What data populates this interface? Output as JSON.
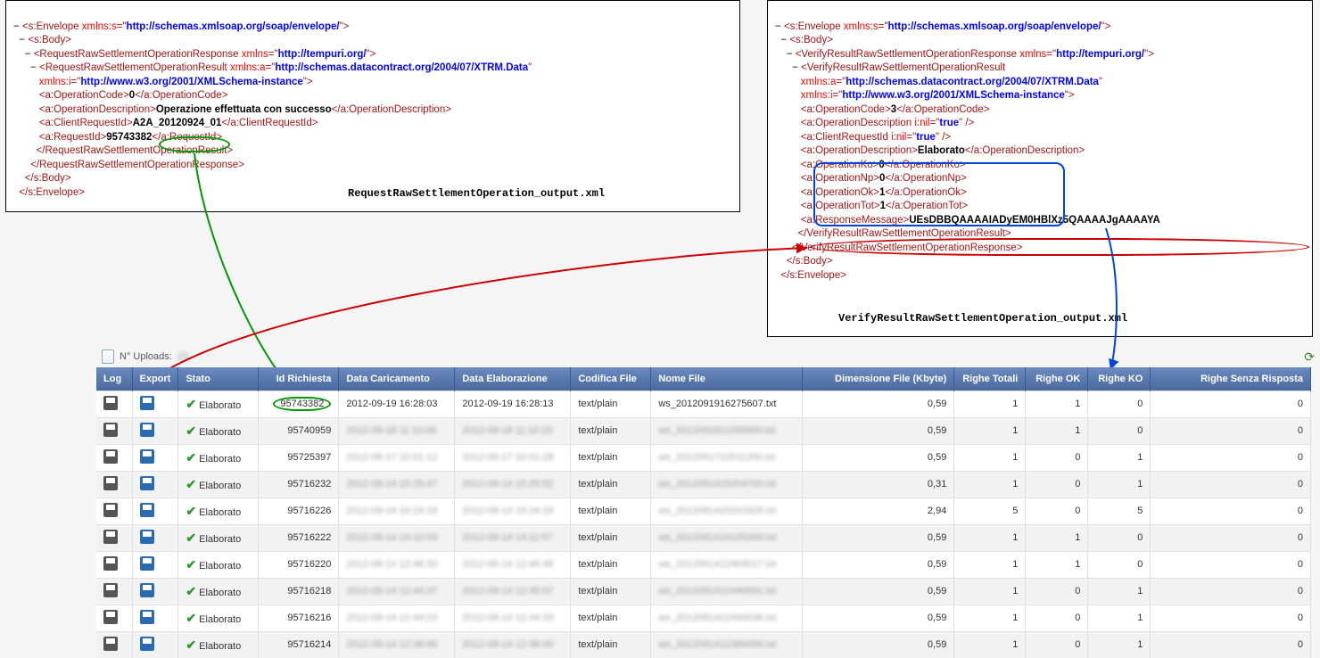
{
  "left_xml": {
    "envelope_open": "s:Envelope",
    "envelope_attr_name": "xmlns:s",
    "envelope_attr_val": "http://schemas.xmlsoap.org/soap/envelope/",
    "body": "s:Body",
    "resp": "RequestRawSettlementOperationResponse",
    "resp_attr_name": "xmlns",
    "resp_attr_val": "http://tempuri.org/",
    "result": "RequestRawSettlementOperationResult",
    "result_a_name": "xmlns:a",
    "result_a_val": "http://schemas.datacontract.org/2004/07/XTRM.Data",
    "result_i_name": "xmlns:i",
    "result_i_val": "http://www.w3.org/2001/XMLSchema-instance",
    "opcode_tag": "a:OperationCode",
    "opcode_val": "0",
    "opdesc_tag": "a:OperationDescription",
    "opdesc_val": "Operazione effettuata con successo",
    "clientreq_tag": "a:ClientRequestId",
    "clientreq_val": "A2A_20120924_01",
    "reqid_tag": "a:RequestId",
    "reqid_val": "95743382",
    "filename": "RequestRawSettlementOperation_output.xml"
  },
  "right_xml": {
    "envelope_open": "s:Envelope",
    "envelope_attr_name": "xmlns:s",
    "envelope_attr_val": "http://schemas.xmlsoap.org/soap/envelope/",
    "body": "s:Body",
    "resp": "VerifyResultRawSettlementOperationResponse",
    "resp_attr_name": "xmlns",
    "resp_attr_val": "http://tempuri.org/",
    "result": "VerifyResultRawSettlementOperationResult",
    "result_a_name": "xmlns:a",
    "result_a_val": "http://schemas.datacontract.org/2004/07/XTRM.Data",
    "result_i_name": "xmlns:i",
    "result_i_val": "http://www.w3.org/2001/XMLSchema-instance",
    "opcode_tag": "a:OperationCode",
    "opcode_val": "3",
    "opdesc_tag_nil": "a:OperationDescription",
    "nil_attr": "i:nil",
    "nil_val": "true",
    "clientreq_tag_nil": "a:ClientRequestId",
    "opdesc_tag": "a:OperationDescription",
    "opdesc_val": "Elaborato",
    "opko_tag": "a:OperationKo",
    "opko_val": "0",
    "opnp_tag": "a:OperationNp",
    "opnp_val": "0",
    "opok_tag": "a:OperationOk",
    "opok_val": "1",
    "optot_tag": "a:OperationTot",
    "optot_val": "1",
    "respmsg_tag": "a:ResponseMessage",
    "respmsg_val": "UEsDBBQAAAAIADyEM0HBlXz5QAAAAJgAAAAYA",
    "filename": "VerifyResultRawSettlementOperation_output.xml"
  },
  "uploads_label": "N° Uploads:",
  "uploads_count": "23",
  "table": {
    "headers": {
      "log": "Log",
      "export": "Export",
      "stato": "Stato",
      "id": "Id Richiesta",
      "dataC": "Data Caricamento",
      "dataE": "Data Elaborazione",
      "codifica": "Codifica File",
      "nome": "Nome File",
      "dim": "Dimensione File (Kbyte)",
      "tot": "Righe Totali",
      "ok": "Righe OK",
      "ko": "Righe KO",
      "sr": "Righe Senza Risposta"
    },
    "rows": [
      {
        "stato": "Elaborato",
        "id": "95743382",
        "dataC": "2012-09-19 16:28:03",
        "dataE": "2012-09-19 16:28:13",
        "cod": "text/plain",
        "nome": "ws_2012091916275607.txt",
        "dim": "0,59",
        "tot": 1,
        "ok": 1,
        "ko": 0,
        "sr": 0,
        "blur": false
      },
      {
        "stato": "Elaborato",
        "id": "95740959",
        "dataC": "2012-09-18 11:10:06",
        "dataE": "2012-09-18 11:10:25",
        "cod": "text/plain",
        "nome": "ws_2012091811095600.txt",
        "dim": "0,59",
        "tot": 1,
        "ok": 1,
        "ko": 0,
        "sr": 0,
        "blur": true
      },
      {
        "stato": "Elaborato",
        "id": "95725397",
        "dataC": "2012-09-17 10:01:12",
        "dataE": "2012-09-17 10:01:28",
        "cod": "text/plain",
        "nome": "ws_2012091710011250.txt",
        "dim": "0,59",
        "tot": 1,
        "ok": 0,
        "ko": 1,
        "sr": 0,
        "blur": true
      },
      {
        "stato": "Elaborato",
        "id": "95716232",
        "dataC": "2012-09-14 15:25:47",
        "dataE": "2012-09-14 15:25:52",
        "cod": "text/plain",
        "nome": "ws_2012091415254700.txt",
        "dim": "0,31",
        "tot": 1,
        "ok": 0,
        "ko": 1,
        "sr": 0,
        "blur": true
      },
      {
        "stato": "Elaborato",
        "id": "95716226",
        "dataC": "2012-09-14 15:24:19",
        "dataE": "2012-09-14 15:24:19",
        "cod": "text/plain",
        "nome": "ws_2012091415241929.txt",
        "dim": "2,94",
        "tot": 5,
        "ok": 0,
        "ko": 5,
        "sr": 0,
        "blur": true
      },
      {
        "stato": "Elaborato",
        "id": "95716222",
        "dataC": "2012-09-14 14:10:53",
        "dataE": "2012-09-14 14:11:57",
        "cod": "text/plain",
        "nome": "ws_2012091414105349.txt",
        "dim": "0,59",
        "tot": 1,
        "ok": 1,
        "ko": 0,
        "sr": 0,
        "blur": true
      },
      {
        "stato": "Elaborato",
        "id": "95716220",
        "dataC": "2012-09-14 12:46:33",
        "dataE": "2012-09-14 12:46:49",
        "cod": "text/plain",
        "nome": "ws_2012091412463017.txt",
        "dim": "0,59",
        "tot": 1,
        "ok": 1,
        "ko": 0,
        "sr": 0,
        "blur": true
      },
      {
        "stato": "Elaborato",
        "id": "95716218",
        "dataC": "2012-09-14 12:44:37",
        "dataE": "2012-09-14 12:45:57",
        "cod": "text/plain",
        "nome": "ws_2012091412440691.txt",
        "dim": "0,59",
        "tot": 1,
        "ok": 0,
        "ko": 1,
        "sr": 0,
        "blur": true
      },
      {
        "stato": "Elaborato",
        "id": "95716216",
        "dataC": "2012-09-14 12:44:23",
        "dataE": "2012-09-14 12:44:33",
        "cod": "text/plain",
        "nome": "ws_2012091412440036.txt",
        "dim": "0,59",
        "tot": 1,
        "ok": 0,
        "ko": 1,
        "sr": 0,
        "blur": true
      },
      {
        "stato": "Elaborato",
        "id": "95716214",
        "dataC": "2012-09-14 12:38:46",
        "dataE": "2012-09-14 12:38:49",
        "cod": "text/plain",
        "nome": "ws_2012091412384494.txt",
        "dim": "0,59",
        "tot": 1,
        "ok": 0,
        "ko": 1,
        "sr": 0,
        "blur": true
      }
    ]
  }
}
